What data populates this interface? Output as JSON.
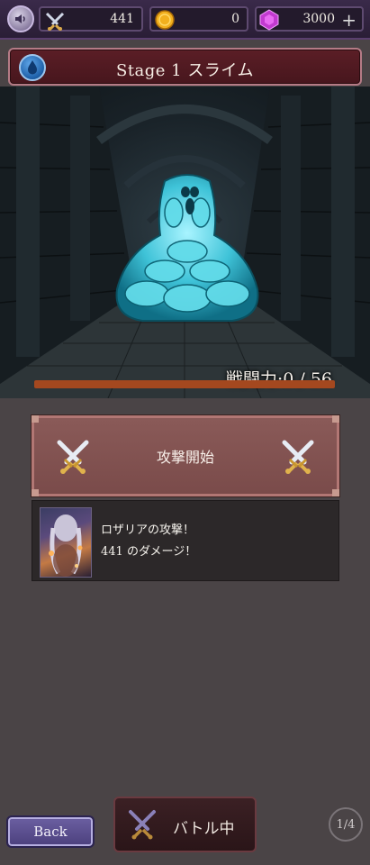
{
  "topbar": {
    "sound_icon": "speaker-icon",
    "swords_value": "441",
    "coins_value": "0",
    "gems_value": "3000",
    "plus_label": "+"
  },
  "stage": {
    "title": "Stage 1 スライム",
    "element_icon": "water-drop-icon"
  },
  "scene": {
    "enemy": "slime",
    "power_text": "戦闘力:0 / 56",
    "power_current": 0,
    "power_max": 56
  },
  "attack": {
    "label": "攻撃開始"
  },
  "log": {
    "line1": "ロザリアの攻撃！",
    "line2": "441 のダメージ！"
  },
  "bottom": {
    "back_label": "Back",
    "battle_label": "バトル中",
    "page_indicator": "1/4"
  },
  "colors": {
    "accent_crimson": "#5b1e26",
    "attack_button": "#8a5a58",
    "back_button": "#5b4f8f",
    "power_fill": "#a4481f"
  }
}
